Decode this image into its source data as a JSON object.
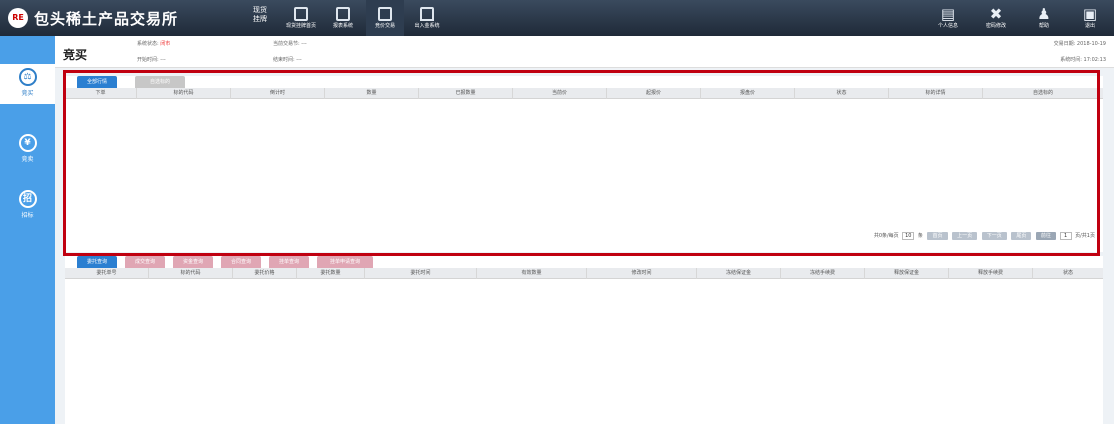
{
  "app": {
    "logo_text": "RE",
    "title": "包头稀土产品交易所"
  },
  "top_nav": [
    {
      "label": "现货挂牌首页",
      "icon": "monitor-icon"
    },
    {
      "label": "报表系统",
      "icon": "report-icon"
    },
    {
      "label": "竞价交易",
      "icon": "auction-icon"
    },
    {
      "label": "出入金系统",
      "icon": "home-icon"
    }
  ],
  "spot_listing": "现货挂牌",
  "right_nav": [
    {
      "label": "个人信息",
      "icon": "user-info-icon"
    },
    {
      "label": "密码修改",
      "icon": "tools-icon"
    },
    {
      "label": "帮助",
      "icon": "help-icon"
    },
    {
      "label": "退出",
      "icon": "exit-icon"
    }
  ],
  "sidebar": [
    {
      "label": "竞买",
      "icon": "gavel-icon",
      "glyph": "⚖",
      "selected": true
    },
    {
      "label": "竞卖",
      "icon": "coin-icon",
      "glyph": "¥",
      "selected": false
    },
    {
      "label": "招标",
      "icon": "tender-icon",
      "glyph": "招",
      "selected": false
    }
  ],
  "header": {
    "page_title": "竞买",
    "system_status_label": "系统状态:",
    "system_status_value": "闭市",
    "start_time": "开始时间: ---",
    "current_section": "当前交易节: ---",
    "end_time": "结束时间: ---",
    "trade_date": "交易日期: 2018-10-19",
    "system_time": "系统时间: 17:02:13"
  },
  "market_panel": {
    "tabs": [
      "全部行情",
      "自选标的"
    ],
    "columns": [
      "下单",
      "标的代码",
      "倒计时",
      "数量",
      "已报数量",
      "当前价",
      "起报价",
      "报盘价",
      "状态",
      "标的详情",
      "自选标的"
    ],
    "pager": {
      "summary": "共0条/每页",
      "page_size": "10",
      "unit": "条",
      "first": "首页",
      "prev": "上一页",
      "next": "下一页",
      "last": "尾页",
      "goto": "前往",
      "page": "1",
      "total": "页/共1页"
    }
  },
  "query_panel": {
    "tabs": [
      "委托查询",
      "成交查询",
      "资金查询",
      "合同查询",
      "挂单查询",
      "挂单申请查询"
    ],
    "columns": [
      "委托单号",
      "标的代码",
      "委托价格",
      "委托数量",
      "委托时间",
      "有效数量",
      "修改时间",
      "冻结保证金",
      "冻结手续费",
      "释放保证金",
      "释放手续费",
      "状态"
    ]
  }
}
